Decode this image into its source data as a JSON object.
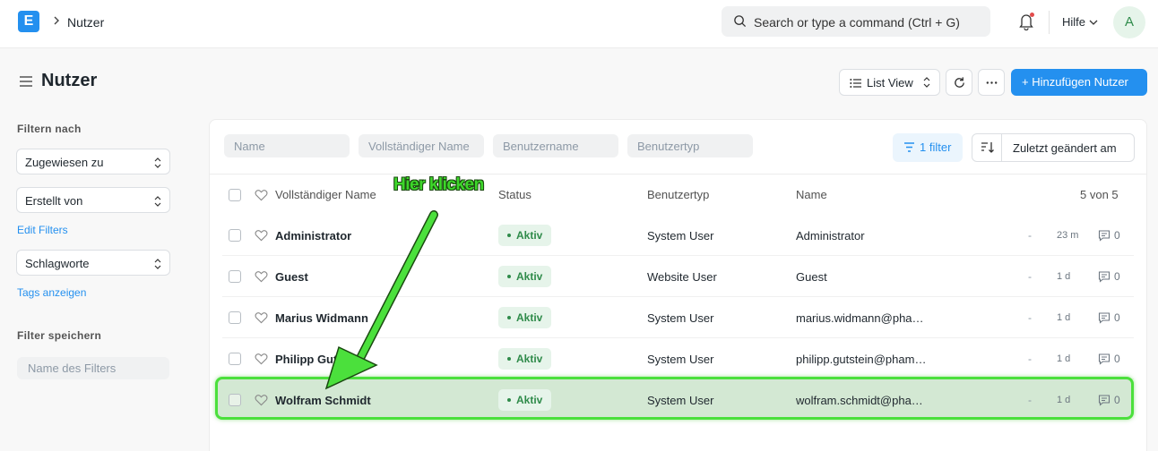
{
  "app": {
    "logo_letter": "E",
    "breadcrumb": "Nutzer",
    "search_placeholder": "Search or type a command (Ctrl + G)",
    "help_label": "Hilfe",
    "avatar_initial": "A"
  },
  "page": {
    "title": "Nutzer",
    "list_view_label": "List View",
    "add_button_label": "+ Hinzufügen Nutzer"
  },
  "sidebar": {
    "filter_heading": "Filtern nach",
    "assigned_to": "Zugewiesen zu",
    "created_by": "Erstellt von",
    "edit_filters": "Edit Filters",
    "tags": "Schlagworte",
    "show_tags": "Tags anzeigen",
    "save_heading": "Filter speichern",
    "filter_name_placeholder": "Name des Filters"
  },
  "filters": {
    "name": "Name",
    "full_name": "Vollständiger Name",
    "username": "Benutzername",
    "user_type": "Benutzertyp",
    "filter_count": "1 filter",
    "sort_label": "Zuletzt geändert am"
  },
  "table": {
    "headers": {
      "full_name": "Vollständiger Name",
      "status": "Status",
      "user_type": "Benutzertyp",
      "name": "Name",
      "count": "5 von 5"
    },
    "rows": [
      {
        "full_name": "Administrator",
        "status": "Aktiv",
        "user_type": "System User",
        "name": "Administrator",
        "dash": "-",
        "time": "23 m",
        "comments": "0"
      },
      {
        "full_name": "Guest",
        "status": "Aktiv",
        "user_type": "Website User",
        "name": "Guest",
        "dash": "-",
        "time": "1 d",
        "comments": "0"
      },
      {
        "full_name": "Marius Widmann",
        "status": "Aktiv",
        "user_type": "System User",
        "name": "marius.widmann@pha…",
        "dash": "-",
        "time": "1 d",
        "comments": "0"
      },
      {
        "full_name": "Philipp Gutstein",
        "status": "Aktiv",
        "user_type": "System User",
        "name": "philipp.gutstein@pham…",
        "dash": "-",
        "time": "1 d",
        "comments": "0"
      },
      {
        "full_name": "Wolfram Schmidt",
        "status": "Aktiv",
        "user_type": "System User",
        "name": "wolfram.schmidt@pha…",
        "dash": "-",
        "time": "1 d",
        "comments": "0"
      }
    ]
  },
  "annotation": {
    "text": "Hier klicken",
    "color": "#4be03c"
  }
}
